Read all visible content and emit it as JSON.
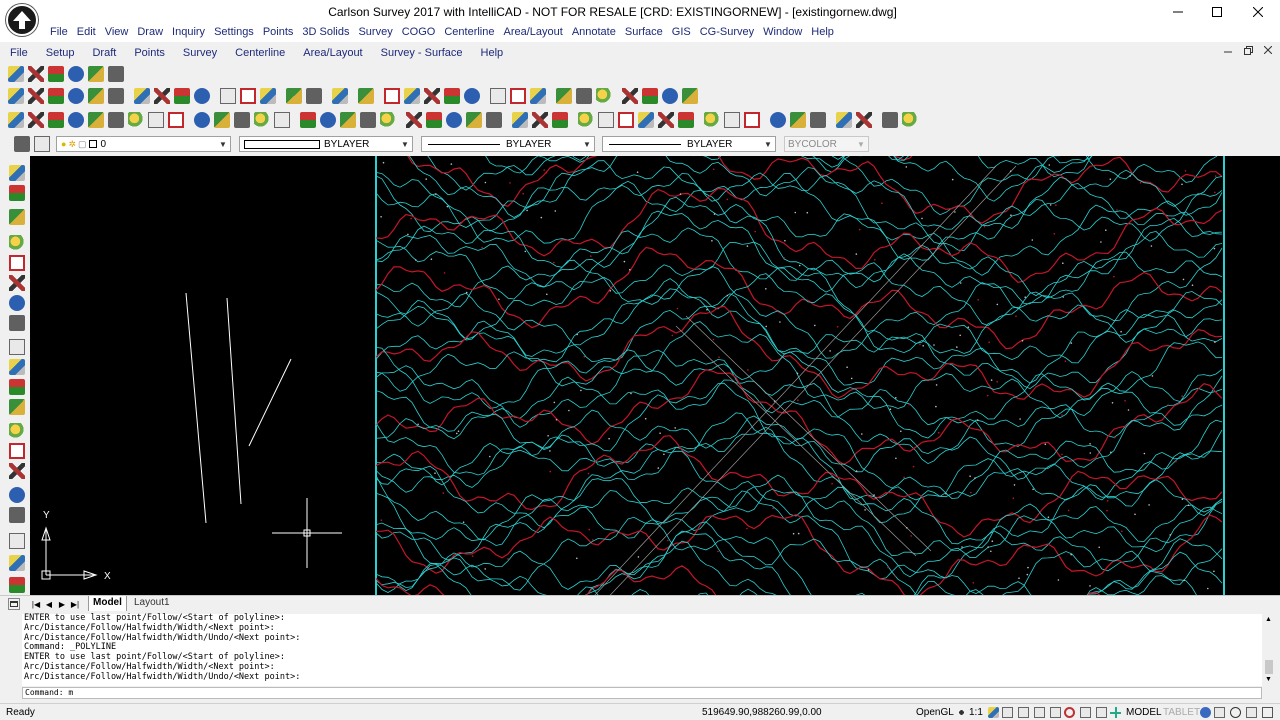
{
  "window": {
    "title": "Carlson Survey 2017 with IntelliCAD - NOT FOR RESALE [CRD: EXISTINGORNEW] - [existingornew.dwg]"
  },
  "menubar_main": [
    "File",
    "Edit",
    "View",
    "Draw",
    "Inquiry",
    "Settings",
    "Points",
    "3D Solids",
    "Survey",
    "COGO",
    "Centerline",
    "Area/Layout",
    "Annotate",
    "Surface",
    "GIS",
    "CG-Survey",
    "Window",
    "Help"
  ],
  "menubar_secondary": [
    "File",
    "Setup",
    "Draft",
    "Points",
    "Survey",
    "Centerline",
    "Area/Layout",
    "Survey - Surface",
    "Help"
  ],
  "properties": {
    "layer": "0",
    "color": "BYLAYER",
    "linetype": "BYLAYER",
    "lineweight": "BYLAYER",
    "plotstyle": "BYCOLOR"
  },
  "canvas": {
    "ucs_x": "X",
    "ucs_y": "Y"
  },
  "tabs": {
    "model": "Model",
    "layout1": "Layout1"
  },
  "command_history": [
    "ENTER to use last point/Follow/<Start of polyline>:",
    "Arc/Distance/Follow/Halfwidth/Width/<Next point>:",
    "Arc/Distance/Follow/Halfwidth/Width/Undo/<Next point>:",
    "Command: _POLYLINE",
    "ENTER to use last point/Follow/<Start of polyline>:",
    "Arc/Distance/Follow/Halfwidth/Width/<Next point>:",
    "Arc/Distance/Follow/Halfwidth/Width/Undo/<Next point>:"
  ],
  "command_prompt": "Command: m",
  "status": {
    "ready": "Ready",
    "coordinates": "519649.90,988260.99,0.00",
    "opengl": "OpenGL",
    "scale": "1:1",
    "model": "MODEL",
    "tablet": "TABLET"
  },
  "colors": {
    "contour_major": "#c4162a",
    "contour_minor": "#2ad1d1",
    "canvas_bg": "#000000"
  }
}
